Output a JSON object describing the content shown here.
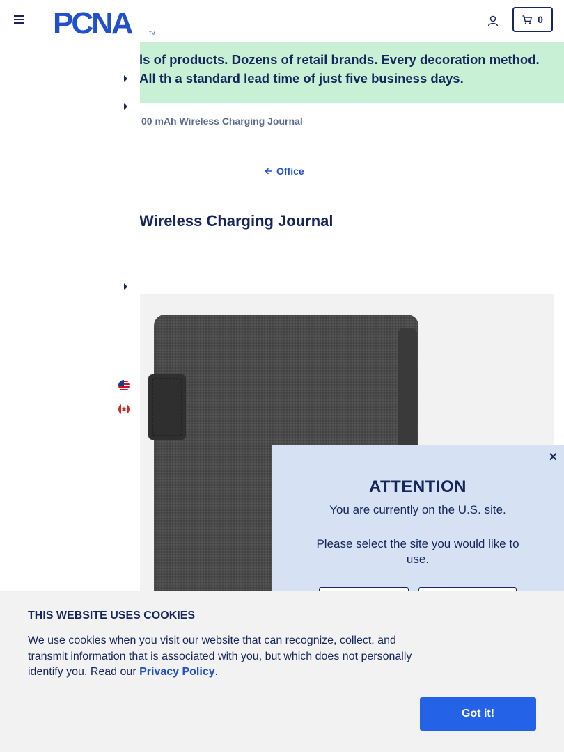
{
  "header": {
    "logo_text": "PCNA",
    "logo_tm": "TM",
    "cart_count": "0",
    "brand_color": "#16255a",
    "accent_color": "#2250c8"
  },
  "promo": {
    "text": "ls of products. Dozens of retail brands. Every decoration method. All th a standard lead time of just five business days.",
    "background": "#c7f0d5"
  },
  "breadcrumb": {
    "current": "00 mAh Wireless Charging Journal"
  },
  "back_link": {
    "label": "Office"
  },
  "product": {
    "title": "Wireless Charging Journal"
  },
  "side_panel": {
    "flags": [
      "us-flag-icon",
      "canada-flag-icon"
    ]
  },
  "modal": {
    "close_label": "×",
    "title": "ATTENTION",
    "line1": "You are currently on the U.S. site.",
    "line2": "Please select the site you would like to use."
  },
  "cookie": {
    "heading": "THIS WEBSITE USES COOKIES",
    "text": "We use cookies when you visit our website that can recognize, collect, and transmit information that is associated with you, but which does not personally identify you. Read our ",
    "link": "Privacy Policy",
    "after": ".",
    "button": "Got it!",
    "button_color": "#2463e8"
  }
}
